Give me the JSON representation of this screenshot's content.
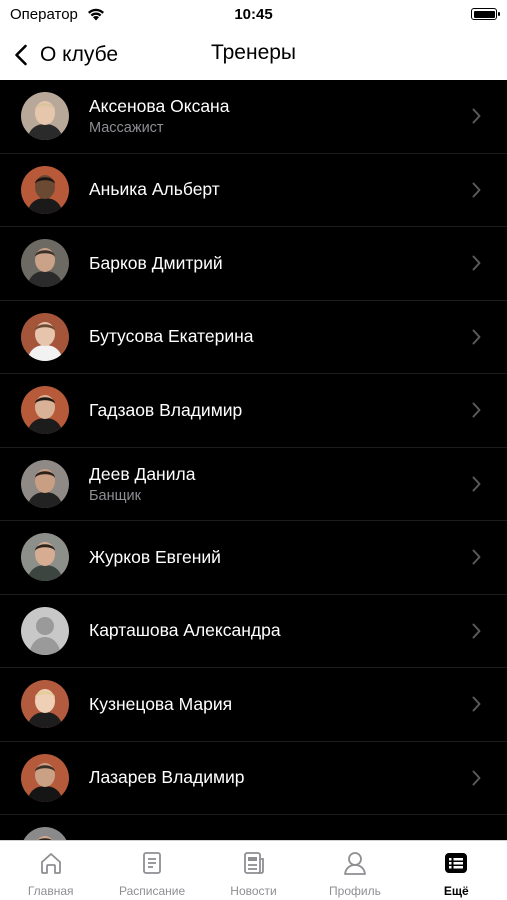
{
  "status_bar": {
    "carrier": "Оператор",
    "time": "10:45"
  },
  "nav": {
    "back_label": "О клубе",
    "title": "Тренеры"
  },
  "trainers": [
    {
      "name": "Аксенова Оксана",
      "role": "Массажист",
      "bg": "#b8a89a",
      "skin": "#e6c7ae",
      "shirt": "#2a2a2a",
      "hair": "#d9c4a0"
    },
    {
      "name": "Аньика Альберт",
      "role": "",
      "bg": "#b8593a",
      "skin": "#6b4a34",
      "shirt": "#1a1a1a",
      "hair": "#1b1410"
    },
    {
      "name": "Барков Дмитрий",
      "role": "",
      "bg": "#6d6a63",
      "skin": "#caa288",
      "shirt": "#2b2b2b",
      "hair": "#3a3028"
    },
    {
      "name": "Бутусова Екатерина",
      "role": "",
      "bg": "#a4553a",
      "skin": "#e7c5ad",
      "shirt": "#f2f2f2",
      "hair": "#6e4a33"
    },
    {
      "name": "Гадзаов Владимир",
      "role": "",
      "bg": "#b65a3a",
      "skin": "#d9b196",
      "shirt": "#1c1c1c",
      "hair": "#1e1712"
    },
    {
      "name": "Деев  Данила",
      "role": "Банщик",
      "bg": "#8f8a86",
      "skin": "#c99f84",
      "shirt": "#222",
      "hair": "#2a2119"
    },
    {
      "name": "Журков Евгений",
      "role": "",
      "bg": "#8d8f8a",
      "skin": "#d6ad93",
      "shirt": "#3c4540",
      "hair": "#2b241d"
    },
    {
      "name": "Карташова Александра",
      "role": "",
      "bg": "#c8c8c8",
      "skin": "#9a9a9a",
      "shirt": "#9a9a9a",
      "hair": "#9a9a9a",
      "placeholder": true
    },
    {
      "name": "Кузнецова Мария",
      "role": "",
      "bg": "#b35b3e",
      "skin": "#efcfb6",
      "shirt": "#1d1d1d",
      "hair": "#e3cd98"
    },
    {
      "name": "Лазарев Владимир",
      "role": "",
      "bg": "#b55a3b",
      "skin": "#caa185",
      "shirt": "#151515",
      "hair": "#3a2e25"
    },
    {
      "name": "",
      "role": "",
      "bg": "#8a8a8a",
      "skin": "#d0ab90",
      "shirt": "#222",
      "hair": "#2e2620"
    }
  ],
  "tabs": [
    {
      "label": "Главная",
      "icon": "home-icon",
      "active": false
    },
    {
      "label": "Расписание",
      "icon": "schedule-icon",
      "active": false
    },
    {
      "label": "Новости",
      "icon": "news-icon",
      "active": false
    },
    {
      "label": "Профиль",
      "icon": "profile-icon",
      "active": false
    },
    {
      "label": "Ещё",
      "icon": "more-icon",
      "active": true
    }
  ],
  "colors": {
    "accent": "#000000",
    "inactive": "#8e8e93",
    "separator": "#1c1c1e"
  }
}
